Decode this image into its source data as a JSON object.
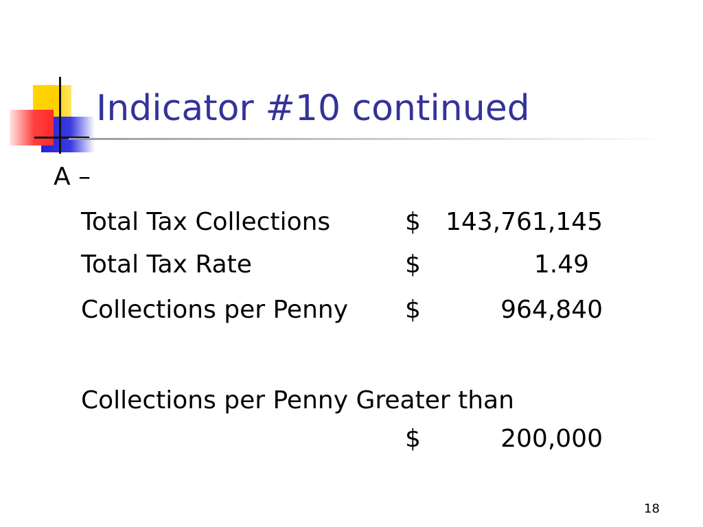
{
  "slide": {
    "title": "Indicator #10 continued",
    "heading": "A –",
    "rows": [
      {
        "label": "Total Tax Collections",
        "currency": "$",
        "amount": "143,761,145"
      },
      {
        "label": "Total Tax Rate",
        "currency": "$",
        "amount": "1.49"
      },
      {
        "label": "Collections per Penny",
        "currency": "$",
        "amount": "964,840"
      }
    ],
    "threshold": {
      "label": "Collections per Penny Greater than",
      "currency": "$",
      "amount": "200,000"
    },
    "page_number": "18"
  },
  "colors": {
    "title": "#333399",
    "accent_yellow": "#ffd400",
    "accent_blue": "#2323d8",
    "accent_red": "#ff3030"
  }
}
